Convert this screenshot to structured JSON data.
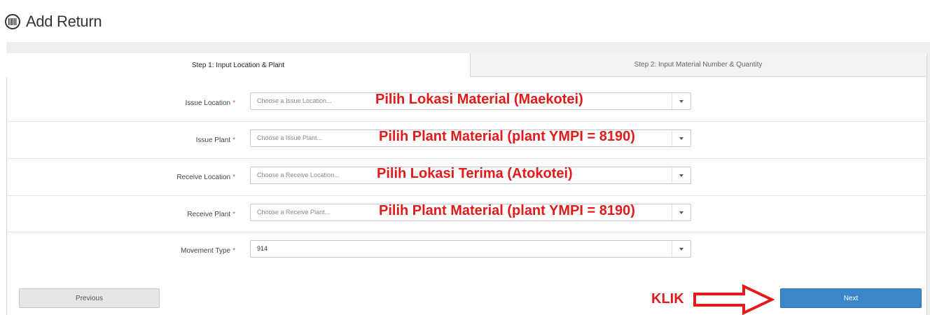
{
  "header": {
    "title": "Add Return",
    "icon": "barcode-icon"
  },
  "tabs": [
    {
      "label": "Step 1: Input Location & Plant",
      "active": true
    },
    {
      "label": "Step 2: Input Material Number & Quantity",
      "active": false
    }
  ],
  "form": {
    "required_marker": "*",
    "fields": [
      {
        "label": "Issue Location",
        "placeholder": "Choose a Issue Location...",
        "value": "",
        "annotation": "Pilih Lokasi Material (Maekotei)"
      },
      {
        "label": "Issue Plant",
        "placeholder": "Choose a Issue Plant...",
        "value": "",
        "annotation": "Pilih Plant Material (plant YMPI = 8190)"
      },
      {
        "label": "Receive Location",
        "placeholder": "Choose a Receive Location...",
        "value": "",
        "annotation": "Pilih Lokasi Terima (Atokotei)"
      },
      {
        "label": "Receive Plant",
        "placeholder": "Choose a Receive Plant...",
        "value": "",
        "annotation": "Pilih Plant Material (plant YMPI = 8190)"
      },
      {
        "label": "Movement Type",
        "placeholder": "",
        "value": "914",
        "annotation": ""
      }
    ]
  },
  "footer": {
    "previous_label": "Previous",
    "next_label": "Next",
    "callout": "KLIK"
  },
  "colors": {
    "primary_button": "#3a86c8",
    "annotation_red": "#e21a1a",
    "required_red": "#d9534f"
  }
}
